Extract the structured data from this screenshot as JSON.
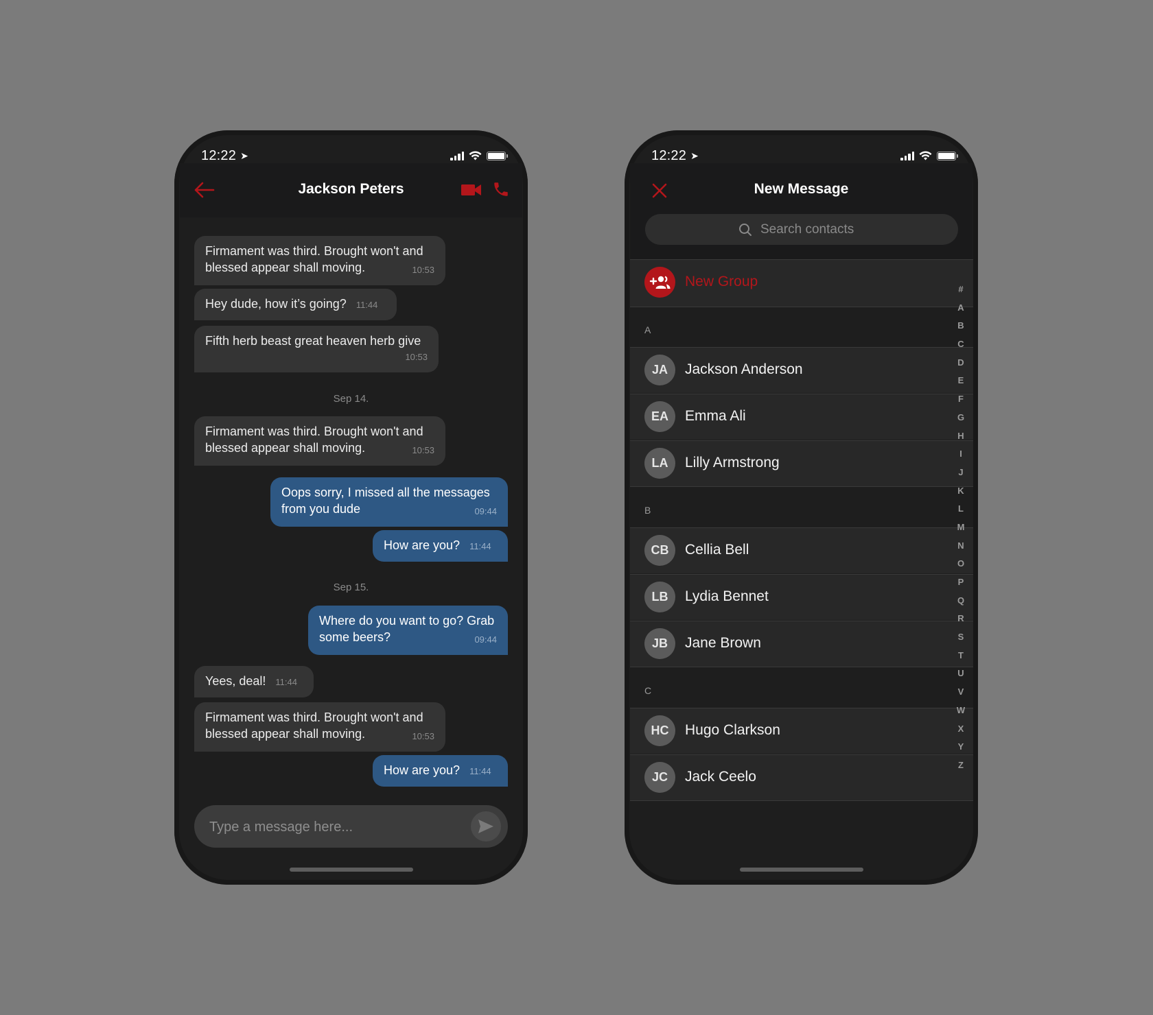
{
  "colors": {
    "accent_red": "#b3161b",
    "outgoing_bubble": "#2e5884",
    "incoming_bubble": "#343434",
    "background": "#7b7b7b"
  },
  "chat_screen": {
    "status_bar": {
      "time": "12:22",
      "icons": [
        "location-arrow-icon",
        "cellular-signal-icon",
        "wifi-icon",
        "battery-icon"
      ]
    },
    "header": {
      "title": "Jackson Peters",
      "back_icon": "arrow-left-icon",
      "video_icon": "video-camera-icon",
      "call_icon": "phone-icon"
    },
    "messages": [
      {
        "direction": "incoming",
        "text": "Firmament was third. Brought won't and blessed appear shall moving.",
        "time": "10:53"
      },
      {
        "direction": "incoming",
        "text": "Hey dude, how it’s going?",
        "time": "11:44"
      },
      {
        "direction": "incoming",
        "text": "Fifth herb beast great heaven herb give",
        "time": "10:53"
      },
      {
        "type": "date",
        "text": "Sep 14."
      },
      {
        "direction": "incoming",
        "text": "Firmament was third. Brought won't and blessed appear shall moving.",
        "time": "10:53"
      },
      {
        "direction": "outgoing",
        "text": "Oops sorry, I missed all the messages from you dude",
        "time": "09:44"
      },
      {
        "direction": "outgoing",
        "text": "How are you?",
        "time": "11:44"
      },
      {
        "type": "date",
        "text": "Sep 15."
      },
      {
        "direction": "outgoing",
        "text": "Where do you want to go? Grab some beers?",
        "time": "09:44"
      },
      {
        "direction": "incoming",
        "text": "Yees, deal!",
        "time": "11:44"
      },
      {
        "direction": "incoming",
        "text": "Firmament was third. Brought won't and blessed appear shall moving.",
        "time": "10:53"
      },
      {
        "direction": "outgoing",
        "text": "How are you?",
        "time": "11:44"
      }
    ],
    "composer": {
      "placeholder": "Type a message here...",
      "value": "",
      "send_icon": "send-icon"
    }
  },
  "contacts_screen": {
    "status_bar": {
      "time": "12:22"
    },
    "header": {
      "title": "New Message",
      "close_icon": "close-icon"
    },
    "search": {
      "placeholder": "Search contacts",
      "value": "",
      "icon": "search-icon"
    },
    "new_group": {
      "label": "New Group",
      "icon": "add-group-icon"
    },
    "sections": [
      {
        "letter": "A",
        "contacts": [
          {
            "initials": "JA",
            "name": "Jackson Anderson"
          },
          {
            "initials": "EA",
            "name": "Emma Ali"
          },
          {
            "initials": "LA",
            "name": "Lilly Armstrong"
          }
        ]
      },
      {
        "letter": "B",
        "contacts": [
          {
            "initials": "CB",
            "name": "Cellia Bell"
          },
          {
            "initials": "LB",
            "name": "Lydia Bennet"
          },
          {
            "initials": "JB",
            "name": "Jane Brown"
          }
        ]
      },
      {
        "letter": "C",
        "contacts": [
          {
            "initials": "HC",
            "name": "Hugo Clarkson"
          },
          {
            "initials": "JC",
            "name": "Jack Ceelo"
          }
        ]
      }
    ],
    "alpha_index": [
      "#",
      "A",
      "B",
      "C",
      "D",
      "E",
      "F",
      "G",
      "H",
      "I",
      "J",
      "K",
      "L",
      "M",
      "N",
      "O",
      "P",
      "Q",
      "R",
      "S",
      "T",
      "U",
      "V",
      "W",
      "X",
      "Y",
      "Z"
    ]
  }
}
